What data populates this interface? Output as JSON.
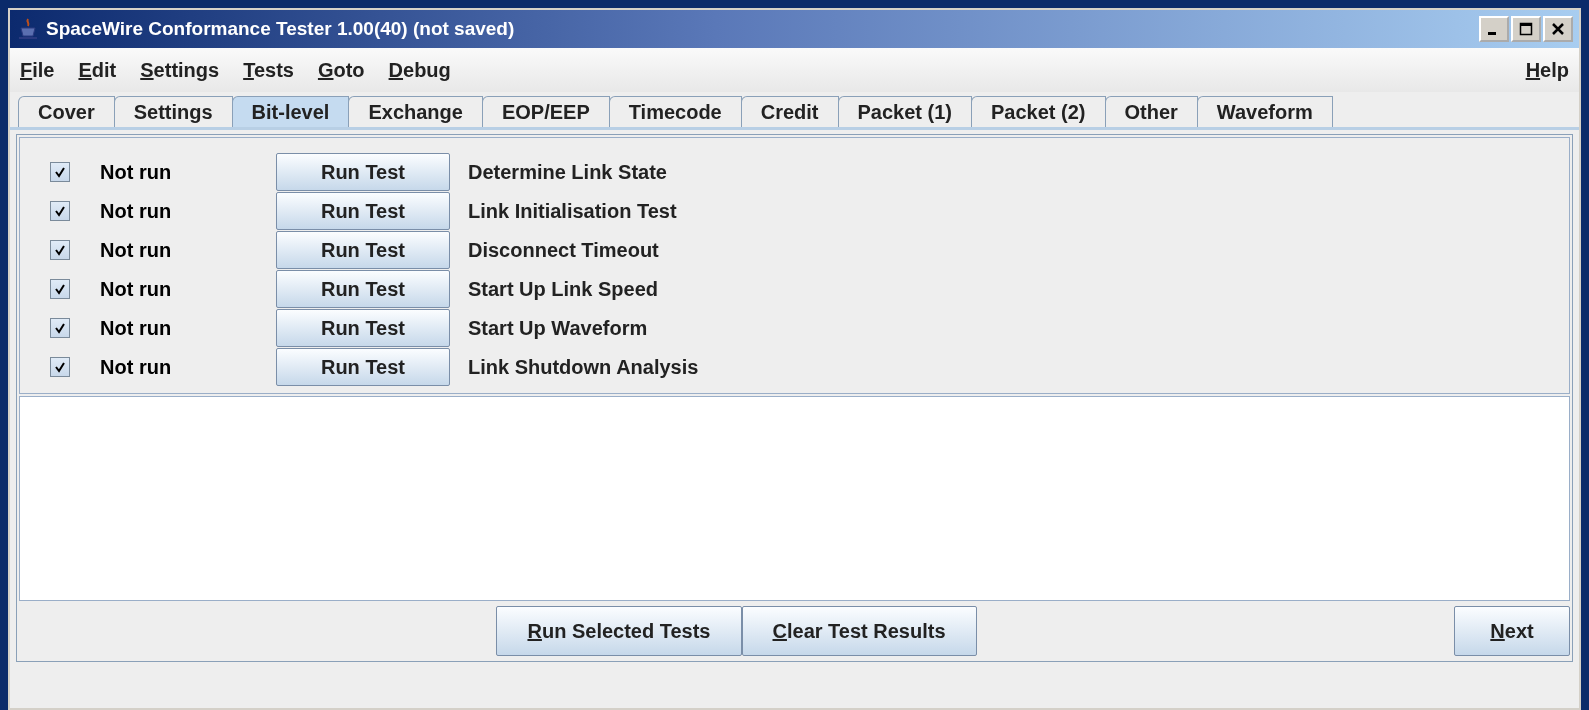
{
  "window": {
    "title": "SpaceWire Conformance Tester 1.00(40) (not saved)"
  },
  "menus": [
    {
      "label": "File",
      "mnemonic_first": true
    },
    {
      "label": "Edit",
      "mnemonic_first": true
    },
    {
      "label": "Settings",
      "mnemonic_first": true
    },
    {
      "label": "Tests",
      "mnemonic_first": true
    },
    {
      "label": "Goto",
      "mnemonic_first": true
    },
    {
      "label": "Debug",
      "mnemonic_first": true
    }
  ],
  "help_menu": {
    "label": "Help",
    "mnemonic_first": true
  },
  "tabs": [
    {
      "label": "Cover",
      "selected": false
    },
    {
      "label": "Settings",
      "selected": false
    },
    {
      "label": "Bit-level",
      "selected": true
    },
    {
      "label": "Exchange",
      "selected": false
    },
    {
      "label": "EOP/EEP",
      "selected": false
    },
    {
      "label": "Timecode",
      "selected": false
    },
    {
      "label": "Credit",
      "selected": false
    },
    {
      "label": "Packet (1)",
      "selected": false
    },
    {
      "label": "Packet (2)",
      "selected": false
    },
    {
      "label": "Other",
      "selected": false
    },
    {
      "label": "Waveform",
      "selected": false
    }
  ],
  "tests": [
    {
      "checked": true,
      "status": "Not run",
      "button": "Run Test",
      "name": "Determine Link State"
    },
    {
      "checked": true,
      "status": "Not run",
      "button": "Run Test",
      "name": "Link Initialisation Test"
    },
    {
      "checked": true,
      "status": "Not run",
      "button": "Run Test",
      "name": "Disconnect Timeout"
    },
    {
      "checked": true,
      "status": "Not run",
      "button": "Run Test",
      "name": "Start Up Link Speed"
    },
    {
      "checked": true,
      "status": "Not run",
      "button": "Run Test",
      "name": "Start Up Waveform"
    },
    {
      "checked": true,
      "status": "Not run",
      "button": "Run Test",
      "name": "Link Shutdown Analysis"
    }
  ],
  "actions": [
    {
      "label": "Run Selected Tests",
      "mnemonic_first": true
    },
    {
      "label": "Clear Test Results",
      "mnemonic_first": true
    }
  ],
  "next_button": {
    "label": "Next",
    "mnemonic_first": true
  }
}
